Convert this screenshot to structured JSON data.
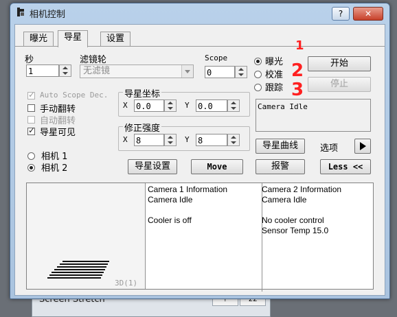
{
  "window": {
    "title": "相机控制",
    "help": "?",
    "close": "✕"
  },
  "background_window": {
    "title": "Screen Stretch",
    "btn1": "?",
    "btn2": "ΣΣ"
  },
  "tabs": [
    {
      "label": "曝光"
    },
    {
      "label": "导星"
    },
    {
      "label": "设置"
    }
  ],
  "exposure": {
    "seconds_label": "秒",
    "seconds_value": "1"
  },
  "filter": {
    "label": "滤镜轮",
    "value": "无滤镜"
  },
  "scope": {
    "label": "Scope",
    "value": "0"
  },
  "mode": {
    "options": [
      "曝光",
      "校准",
      "跟踪"
    ],
    "selected": 0
  },
  "buttons": {
    "start": "开始",
    "stop": "停止",
    "guide_curve": "导星曲线",
    "options": "选项",
    "guide_settings": "导星设置",
    "move": "Move",
    "alarm": "报警",
    "less": "Less <<"
  },
  "checks": {
    "auto_scope_dec": {
      "label": "Auto Scope Dec.",
      "checked": true,
      "disabled": true
    },
    "manual_flip": {
      "label": "手动翻转",
      "checked": false
    },
    "auto_flip": {
      "label": "自动翻转",
      "checked": false,
      "disabled": true
    },
    "star_visible": {
      "label": "导星可见",
      "checked": true
    }
  },
  "guide_coords": {
    "label": "导星坐标",
    "x_label": "X",
    "x": "0.0",
    "y_label": "Y",
    "y": "0.0"
  },
  "correction": {
    "label": "修正强度",
    "x_label": "X",
    "x": "8",
    "y_label": "Y",
    "y": "8"
  },
  "camera": {
    "options": [
      "相机 1",
      "相机 2"
    ],
    "selected": 1
  },
  "status_text": "Camera Idle",
  "preview": {
    "label": "3D(1)"
  },
  "info": {
    "camera1": [
      "Camera 1 Information",
      "Camera Idle",
      "",
      "Cooler is off"
    ],
    "camera2": [
      "Camera 2 Information",
      "Camera Idle",
      "",
      "No cooler control",
      "Sensor Temp 15.0"
    ]
  },
  "annotations": [
    "1",
    "2",
    "3"
  ],
  "colors": {
    "annotation": "#ff2020",
    "titlebar": "#b9d1ea",
    "close": "#c7402a"
  }
}
